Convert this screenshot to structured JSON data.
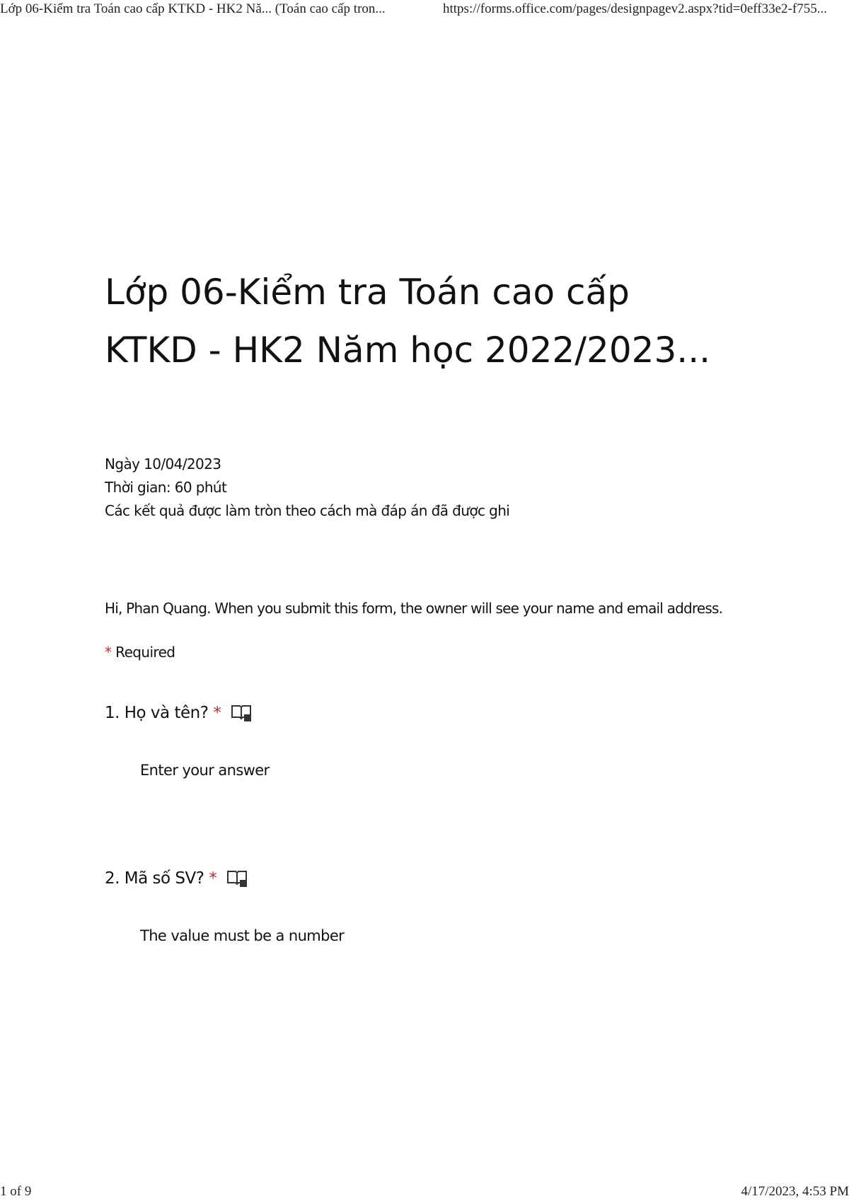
{
  "print_header": {
    "page_title": "Lớp 06-Kiểm tra Toán cao cấp KTKD - HK2 Nă... (Toán cao cấp tron...",
    "url": "https://forms.office.com/pages/designpagev2.aspx?tid=0eff33e2-f755..."
  },
  "form": {
    "title_line1": "Lớp 06-Kiểm tra Toán cao cấp",
    "title_line2": "KTKD - HK2 Năm học 2022/2023...",
    "description": {
      "line1": "Ngày 10/04/2023",
      "line2": "Thời gian: 60 phút",
      "line3": "Các kết quả được làm tròn theo cách mà đáp án đã được ghi"
    },
    "identity_notice": "Hi, Phan Quang. When you submit this form, the owner will see your name and email address.",
    "required_asterisk": "*",
    "required_label": "Required",
    "questions": [
      {
        "label": "1. Họ và tên?",
        "required_mark": "*",
        "icon": "immersive-reader-icon",
        "answer_placeholder": "Enter your answer",
        "answer_value": ""
      },
      {
        "label": "2. Mã số SV?",
        "required_mark": "*",
        "icon": "immersive-reader-icon",
        "answer_placeholder": "The value must be a number",
        "answer_value": ""
      }
    ]
  },
  "print_footer": {
    "page_count": "1 of 9",
    "print_time": "4/17/2023, 4:53 PM"
  },
  "colors": {
    "required_red": "#c4262e",
    "text": "#111111"
  }
}
